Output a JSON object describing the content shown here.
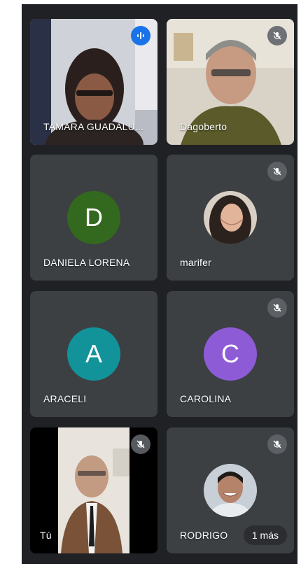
{
  "participants": [
    {
      "name": "TAMARA GUADALU...",
      "mic": "speaking",
      "media": "video"
    },
    {
      "name": "Dagoberto",
      "mic": "muted",
      "media": "video"
    },
    {
      "name": "DANIELA LORENA",
      "mic": "on",
      "media": "letter",
      "initial": "D",
      "color": "#33691e"
    },
    {
      "name": "marifer",
      "mic": "muted",
      "media": "photo"
    },
    {
      "name": "ARACELI",
      "mic": "on",
      "media": "letter",
      "initial": "A",
      "color": "#12939a"
    },
    {
      "name": "CAROLINA",
      "mic": "muted",
      "media": "letter",
      "initial": "C",
      "color": "#8e5bd6"
    },
    {
      "name": "Tú",
      "mic": "muted",
      "media": "video"
    },
    {
      "name": "RODRIGO",
      "mic": "muted",
      "media": "photo"
    }
  ],
  "more_label": "1 más",
  "icons": {
    "mic_off": "mic-off-icon",
    "speaking": "audio-level-icon"
  }
}
